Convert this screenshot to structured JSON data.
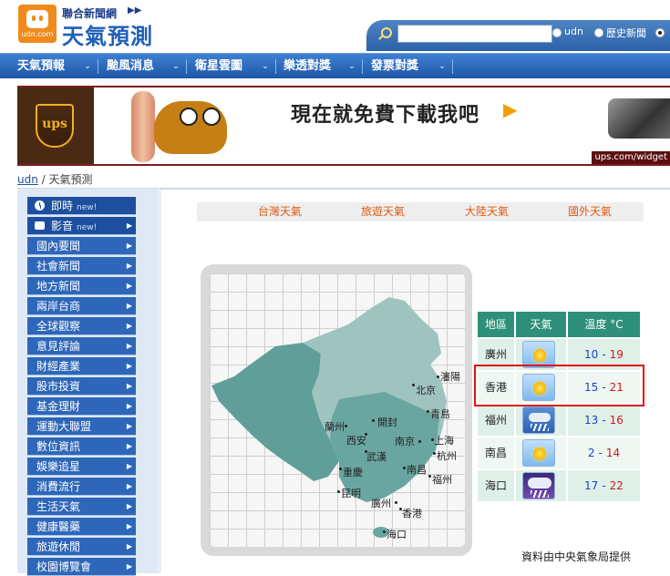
{
  "header": {
    "logo_text": "udn.com",
    "network_name": "聯合新聞網",
    "network_arrows": "▶▶",
    "site_title": "天氣預測"
  },
  "search": {
    "value": "",
    "placeholder": "",
    "options": [
      {
        "label": "udn",
        "selected": false
      },
      {
        "label": "歷史新聞",
        "selected": false
      },
      {
        "label": "",
        "selected": true
      }
    ]
  },
  "nav": {
    "items": [
      "天氣預報",
      "颱風消息",
      "衛星雲圖",
      "樂透對獎",
      "發票對獎"
    ],
    "arrow": "⌄"
  },
  "banner": {
    "brand": "ups",
    "headline": "現在就免費下載我吧",
    "arrow": "▶",
    "url": "ups.com/widget"
  },
  "breadcrumb": {
    "home": "udn",
    "separator": "/",
    "current": "天氣預測"
  },
  "sidebar": {
    "items": [
      {
        "label": "即時",
        "tag": "new!",
        "icon": "clock-icon"
      },
      {
        "label": "影音",
        "tag": "new!",
        "icon": "camera-icon"
      },
      {
        "label": "國內要聞"
      },
      {
        "label": "社會新聞"
      },
      {
        "label": "地方新聞"
      },
      {
        "label": "兩岸台商"
      },
      {
        "label": "全球觀察"
      },
      {
        "label": "意見評論"
      },
      {
        "label": "財經產業"
      },
      {
        "label": "股市投資"
      },
      {
        "label": "基金理財"
      },
      {
        "label": "運動大聯盟"
      },
      {
        "label": "數位資訊"
      },
      {
        "label": "娛樂追星"
      },
      {
        "label": "消費流行"
      },
      {
        "label": "生活天氣"
      },
      {
        "label": "健康醫藥"
      },
      {
        "label": "旅遊休閒"
      },
      {
        "label": "校園博覽會"
      }
    ],
    "arrow": "▶"
  },
  "tabs": [
    "台灣天氣",
    "旅遊天氣",
    "大陸天氣",
    "國外天氣"
  ],
  "map": {
    "cities": [
      "瀋陽",
      "北京",
      "青島",
      "開封",
      "蘭州",
      "西安",
      "南京",
      "上海",
      "武漢",
      "杭州",
      "重慶",
      "南昌",
      "福州",
      "昆明",
      "廣州",
      "香港",
      "海口"
    ]
  },
  "weather_table": {
    "headers": {
      "city": "地區",
      "weather": "天氣",
      "temp": "溫度 °C"
    },
    "rows": [
      {
        "city": "廣州",
        "icon": "sunny-icon",
        "lo": "10",
        "hi": "19"
      },
      {
        "city": "香港",
        "icon": "sunny-icon",
        "lo": "15",
        "hi": "21",
        "highlighted": true
      },
      {
        "city": "福州",
        "icon": "rain-icon",
        "lo": "13",
        "hi": "16"
      },
      {
        "city": "南昌",
        "icon": "sunny-icon",
        "lo": "2",
        "hi": "14"
      },
      {
        "city": "海口",
        "icon": "night-rain-icon",
        "lo": "17",
        "hi": "22"
      }
    ],
    "dash": "-"
  },
  "source_note": "資料由中央氣象局提供",
  "colors": {
    "nav_blue": "#2f6cc0",
    "sidebar_blue": "#2e67b9",
    "table_header": "#2e8f7a",
    "highlight_red": "#e01010",
    "tab_text": "#e05a10"
  }
}
